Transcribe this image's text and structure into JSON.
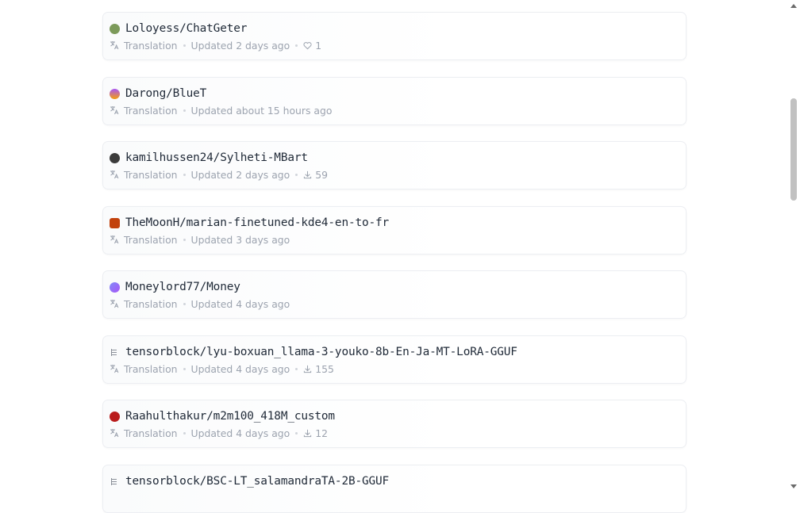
{
  "models": [
    {
      "name": "Loloyess/ChatGeter",
      "task": "Translation",
      "updated": "Updated 2 days ago",
      "stat_type": "likes",
      "stat": "1",
      "avatar": "#7c9a5a"
    },
    {
      "name": "Darong/BlueT",
      "task": "Translation",
      "updated": "Updated about 15 hours ago",
      "stat_type": "",
      "stat": "",
      "avatar": "linear-gradient(180deg,#a855f7,#f59e0b)"
    },
    {
      "name": "kamilhussen24/Sylheti-MBart",
      "task": "Translation",
      "updated": "Updated 2 days ago",
      "stat_type": "downloads",
      "stat": "59",
      "avatar": "#3b3b3b"
    },
    {
      "name": "TheMoonH/marian-finetuned-kde4-en-to-fr",
      "task": "Translation",
      "updated": "Updated 3 days ago",
      "stat_type": "",
      "stat": "",
      "avatar": "#c2410c"
    },
    {
      "name": "Moneylord77/Money",
      "task": "Translation",
      "updated": "Updated 4 days ago",
      "stat_type": "",
      "stat": "",
      "avatar": "linear-gradient(135deg,#818cf8,#a855f7)"
    },
    {
      "name": "tensorblock/lyu-boxuan_llama-3-youko-8b-En-Ja-MT-LoRA-GGUF",
      "task": "Translation",
      "updated": "Updated 4 days ago",
      "stat_type": "downloads",
      "stat": "155",
      "avatar": "org"
    },
    {
      "name": "Raahulthakur/m2m100_418M_custom",
      "task": "Translation",
      "updated": "Updated 4 days ago",
      "stat_type": "downloads",
      "stat": "12",
      "avatar": "#b91c1c"
    },
    {
      "name": "tensorblock/BSC-LT_salamandraTA-2B-GGUF",
      "task": "",
      "updated": "",
      "stat_type": "",
      "stat": "",
      "avatar": "org"
    }
  ]
}
